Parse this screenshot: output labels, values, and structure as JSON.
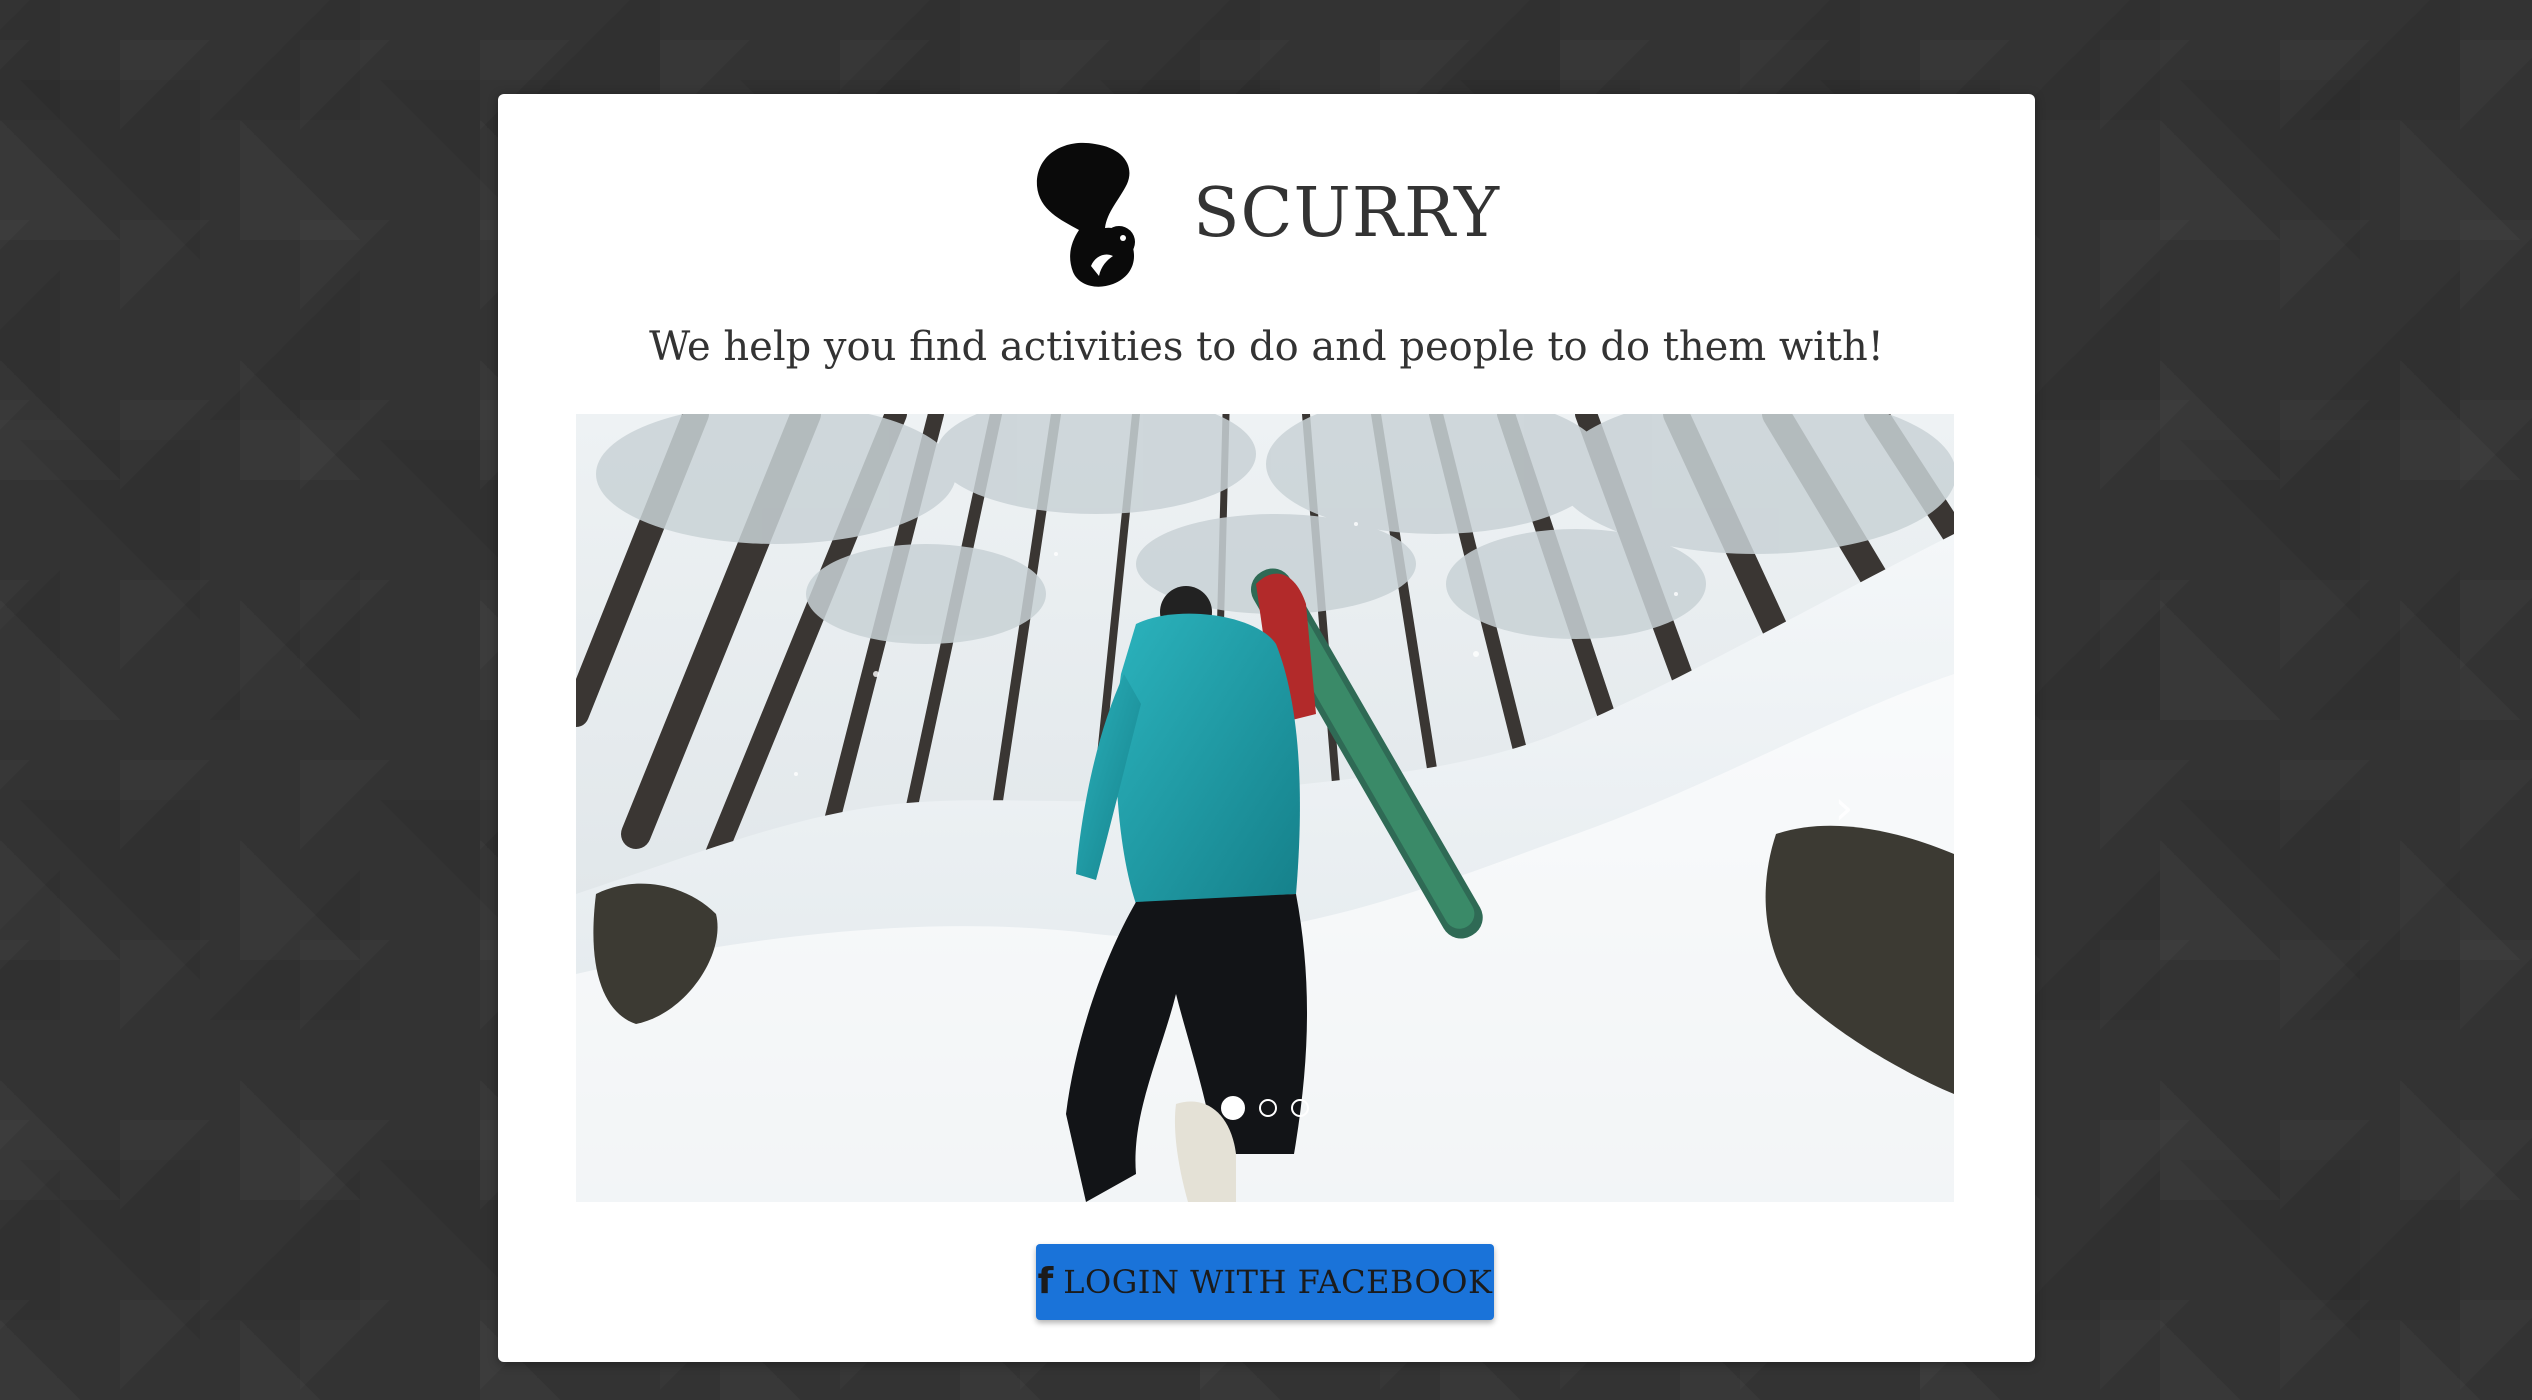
{
  "app": {
    "name": "SCURRY",
    "tagline": "We help you find activities to do and people to do them with!",
    "logo_icon": "squirrel-icon"
  },
  "carousel": {
    "slide_count": 3,
    "active_index": 0,
    "next_icon": "chevron-right-icon",
    "next_glyph": "›"
  },
  "login": {
    "button_label": "LOGIN WITH FACEBOOK",
    "icon": "facebook-icon",
    "icon_glyph": "f",
    "color": "#1a73d9"
  },
  "colors": {
    "background": "#333333",
    "card": "#ffffff",
    "text": "#333333"
  }
}
